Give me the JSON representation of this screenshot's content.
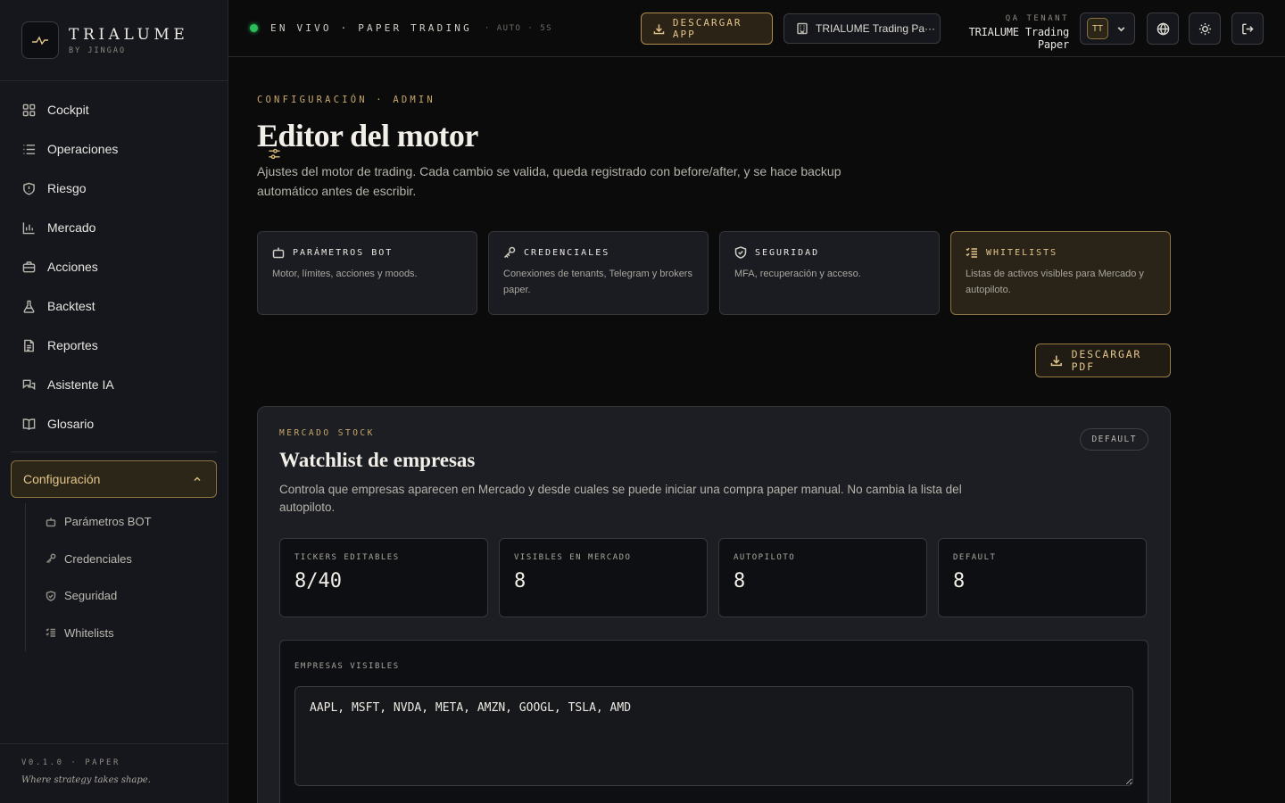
{
  "brand": {
    "name": "TRIALUME",
    "sub": "BY JINGAO"
  },
  "sidebar": {
    "items": [
      {
        "label": "Cockpit",
        "icon": "grid-icon"
      },
      {
        "label": "Operaciones",
        "icon": "list-icon"
      },
      {
        "label": "Riesgo",
        "icon": "shield-icon"
      },
      {
        "label": "Mercado",
        "icon": "bar-chart-icon"
      },
      {
        "label": "Acciones",
        "icon": "briefcase-icon"
      },
      {
        "label": "Backtest",
        "icon": "flask-icon"
      },
      {
        "label": "Reportes",
        "icon": "document-icon"
      },
      {
        "label": "Asistente IA",
        "icon": "chat-icon"
      },
      {
        "label": "Glosario",
        "icon": "book-icon"
      }
    ],
    "config": {
      "label": "Configuración",
      "icon": "sliders-icon"
    },
    "subitems": [
      {
        "label": "Parámetros BOT",
        "icon": "bot-icon"
      },
      {
        "label": "Credenciales",
        "icon": "key-icon"
      },
      {
        "label": "Seguridad",
        "icon": "shield-check-icon"
      },
      {
        "label": "Whitelists",
        "icon": "checklist-icon"
      }
    ],
    "version": "V0.1.0 · PAPER",
    "tagline": "Where strategy takes shape."
  },
  "topbar": {
    "live": "EN VIVO · PAPER TRADING",
    "auto": "· AUTO · 5S",
    "download_app": "DESCARGAR APP",
    "tenant_button": "TRIALUME Trading Pa···",
    "tenant_label": "QA TENANT",
    "tenant_name": "TRIALUME Trading Paper",
    "avatar": "TT",
    "live_color": "#2bbf5c"
  },
  "page": {
    "eyebrow": "CONFIGURACIÓN · ADMIN",
    "title": "Editor del motor",
    "description": "Ajustes del motor de trading. Cada cambio se valida, queda registrado con before/after, y se hace backup automático antes de escribir.",
    "cards": [
      {
        "title": "PARÁMETROS BOT",
        "desc": "Motor, límites, acciones y moods.",
        "icon": "bot-icon"
      },
      {
        "title": "CREDENCIALES",
        "desc": "Conexiones de tenants, Telegram y brokers paper.",
        "icon": "key-icon"
      },
      {
        "title": "SEGURIDAD",
        "desc": "MFA, recuperación y acceso.",
        "icon": "shield-check-icon"
      },
      {
        "title": "WHITELISTS",
        "desc": "Listas de activos visibles para Mercado y autopiloto.",
        "icon": "checklist-icon"
      }
    ],
    "pdf_button": "DESCARGAR PDF"
  },
  "panel": {
    "eyebrow": "MERCADO STOCK",
    "badge": "DEFAULT",
    "title": "Watchlist de empresas",
    "description": "Controla que empresas aparecen en Mercado y desde cuales se puede iniciar una compra paper manual. No cambia la lista del autopiloto.",
    "stats": [
      {
        "label": "TICKERS EDITABLES",
        "value": "8/40"
      },
      {
        "label": "VISIBLES EN MERCADO",
        "value": "8"
      },
      {
        "label": "AUTOPILOTO",
        "value": "8"
      },
      {
        "label": "DEFAULT",
        "value": "8"
      }
    ],
    "list_label": "EMPRESAS VISIBLES",
    "list_value": "AAPL, MSFT, NVDA, META, AMZN, GOOGL, TSLA, AMD"
  },
  "colors": {
    "accent": "#e3c48b",
    "background": "#0b0b0c",
    "sidebar": "#15171c"
  }
}
